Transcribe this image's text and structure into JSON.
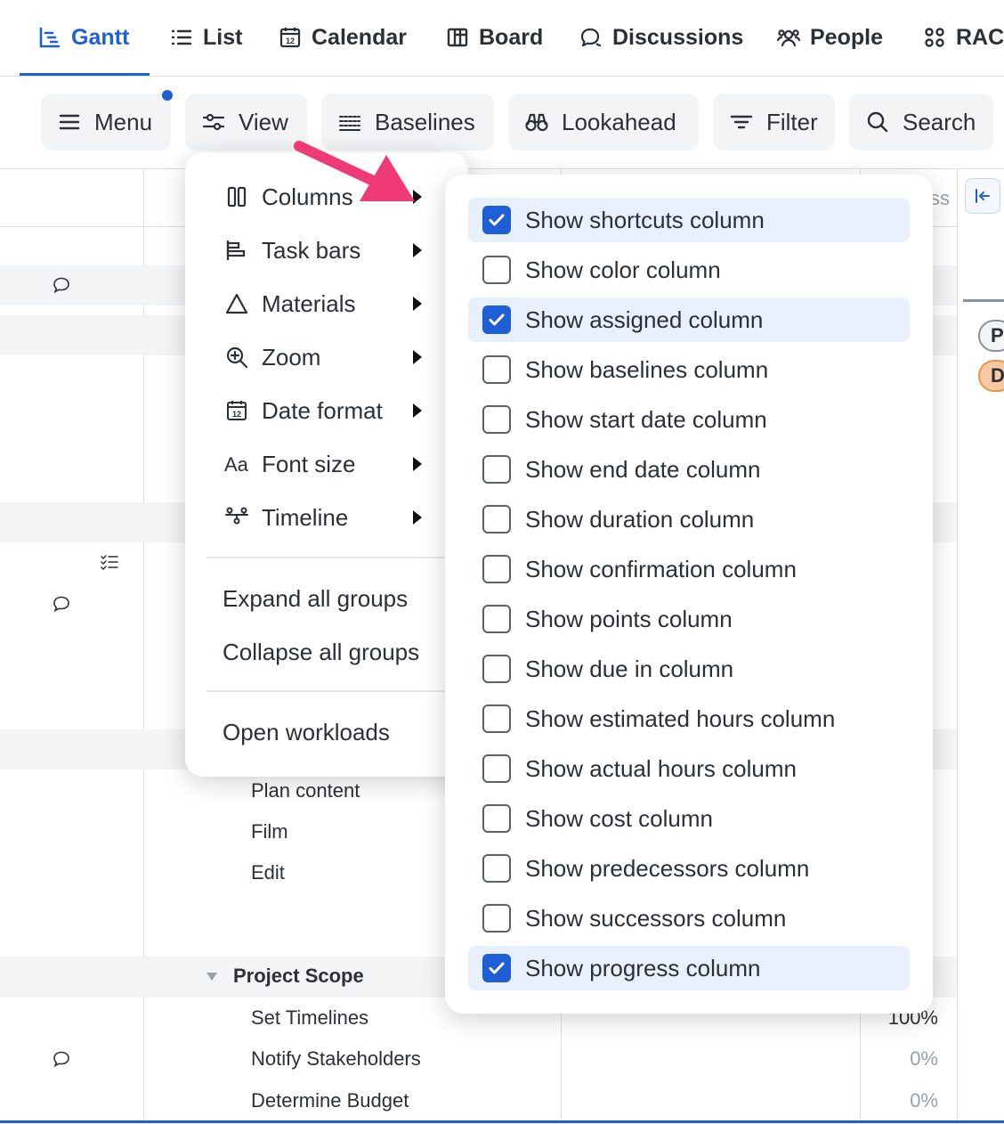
{
  "tabs": [
    {
      "label": "Gantt",
      "icon": "gantt-icon",
      "active": true
    },
    {
      "label": "List",
      "icon": "list-icon"
    },
    {
      "label": "Calendar",
      "icon": "calendar-icon"
    },
    {
      "label": "Board",
      "icon": "board-icon"
    },
    {
      "label": "Discussions",
      "icon": "discussions-icon"
    },
    {
      "label": "People",
      "icon": "people-icon"
    },
    {
      "label": "RACI",
      "icon": "raci-icon"
    }
  ],
  "toolbar": {
    "menu_label": "Menu",
    "view_label": "View",
    "baselines_label": "Baselines",
    "lookahead_label": "Lookahead",
    "filter_label": "Filter",
    "search_label": "Search"
  },
  "view_menu": {
    "items": [
      {
        "label": "Columns",
        "icon": "columns-icon",
        "submenu": true
      },
      {
        "label": "Task bars",
        "icon": "task-bars-icon",
        "submenu": true
      },
      {
        "label": "Materials",
        "icon": "triangle-icon",
        "submenu": true
      },
      {
        "label": "Zoom",
        "icon": "zoom-icon",
        "submenu": true
      },
      {
        "label": "Date format",
        "icon": "calendar-icon",
        "submenu": true
      },
      {
        "label": "Font size",
        "icon": "font-size-icon",
        "submenu": true
      },
      {
        "label": "Timeline",
        "icon": "timeline-icon",
        "submenu": true
      }
    ],
    "group_actions": [
      "Expand all groups",
      "Collapse all groups"
    ],
    "workload_action": "Open workloads"
  },
  "columns_submenu": [
    {
      "label": "Show shortcuts column",
      "checked": true
    },
    {
      "label": "Show color column",
      "checked": false
    },
    {
      "label": "Show assigned column",
      "checked": true
    },
    {
      "label": "Show baselines column",
      "checked": false
    },
    {
      "label": "Show start date column",
      "checked": false
    },
    {
      "label": "Show end date column",
      "checked": false
    },
    {
      "label": "Show duration column",
      "checked": false
    },
    {
      "label": "Show confirmation column",
      "checked": false
    },
    {
      "label": "Show points column",
      "checked": false
    },
    {
      "label": "Show due in column",
      "checked": false
    },
    {
      "label": "Show estimated hours column",
      "checked": false
    },
    {
      "label": "Show actual hours column",
      "checked": false
    },
    {
      "label": "Show cost column",
      "checked": false
    },
    {
      "label": "Show predecessors column",
      "checked": false
    },
    {
      "label": "Show successors column",
      "checked": false
    },
    {
      "label": "Show progress column",
      "checked": true
    }
  ],
  "grid": {
    "progress_header_fragment": "ss",
    "tasks_a": [
      "Plan content",
      "Film",
      "Edit"
    ],
    "group_title": "Project Scope",
    "tasks_b": [
      {
        "name": "Set Timelines",
        "progress": "100%"
      },
      {
        "name": "Notify Stakeholders",
        "progress": "0%"
      },
      {
        "name": "Determine Budget",
        "progress": "0%"
      }
    ],
    "pills": [
      "P",
      "D"
    ]
  },
  "colors": {
    "accent": "#1f5fd6",
    "annotation_arrow": "#f03a78",
    "checked_row": "#e9f0fd",
    "pill_orange": "#f8c9a0"
  }
}
